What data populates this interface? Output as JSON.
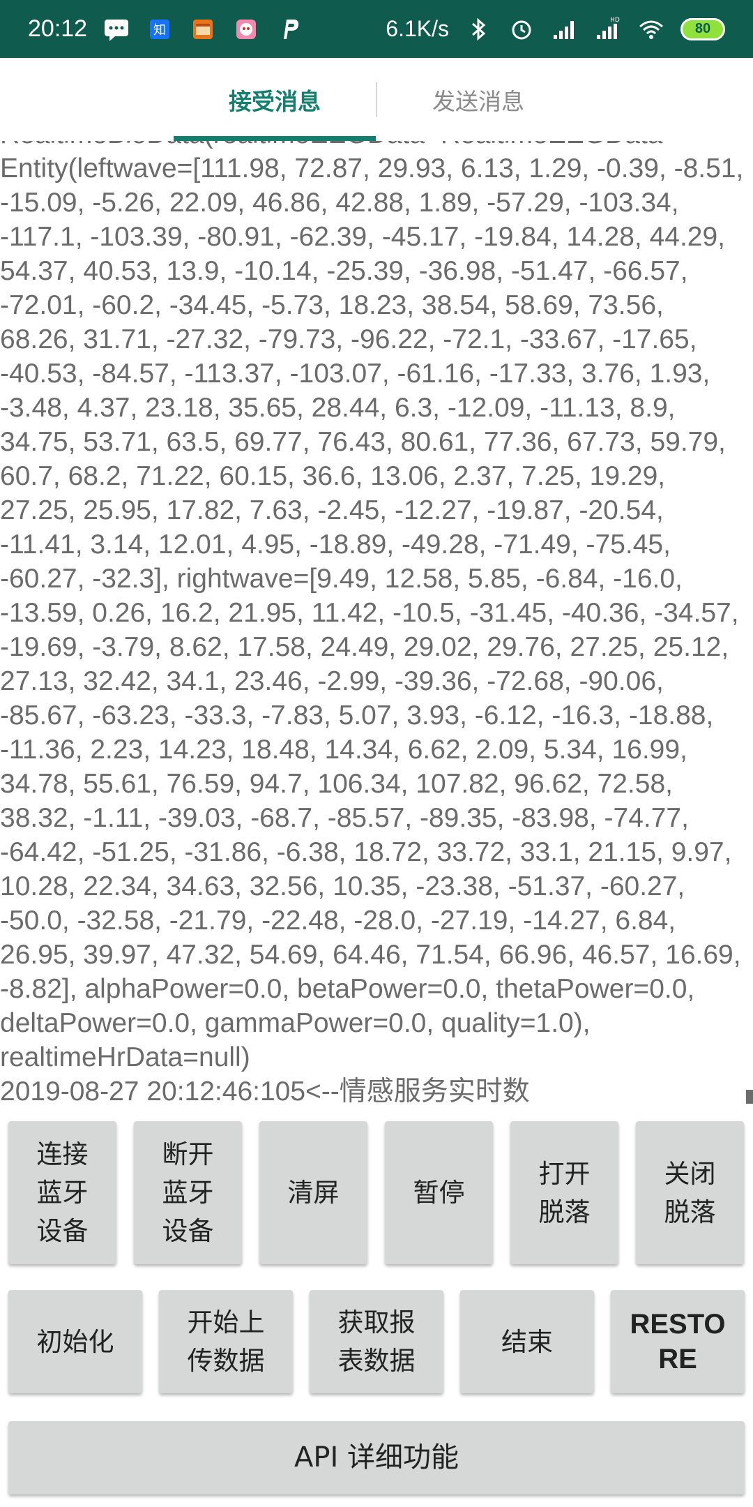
{
  "status_bar": {
    "time": "20:12",
    "net_speed": "6.1K/s",
    "battery": "80",
    "notification_icons": [
      "message-icon",
      "zhihu-icon",
      "calendar-app-icon",
      "app-icon",
      "p-app-icon"
    ],
    "system_icons": [
      "bluetooth-icon",
      "alarm-icon",
      "signal-icon",
      "hd-signal-icon",
      "wifi-icon"
    ],
    "bar_color": "#0f5c4e",
    "battery_color": "#8ee23b"
  },
  "tabs": {
    "receive": "接受消息",
    "send": "发送消息",
    "active_color": "#147f6f"
  },
  "log": {
    "text": "RealtimeBioData(realtimeEEGData=RealtimeEEGData\nEntity(leftwave=[111.98, 72.87, 29.93, 6.13, 1.29, -0.39, -8.51, -15.09, -5.26, 22.09, 46.86, 42.88, 1.89, -57.29, -103.34, -117.1, -103.39, -80.91, -62.39, -45.17, -19.84, 14.28, 44.29, 54.37, 40.53, 13.9, -10.14, -25.39, -36.98, -51.47, -66.57, -72.01, -60.2, -34.45, -5.73, 18.23, 38.54, 58.69, 73.56, 68.26, 31.71, -27.32, -79.73, -96.22, -72.1, -33.67, -17.65, -40.53, -84.57, -113.37, -103.07, -61.16, -17.33, 3.76, 1.93, -3.48, 4.37, 23.18, 35.65, 28.44, 6.3, -12.09, -11.13, 8.9, 34.75, 53.71, 63.5, 69.77, 76.43, 80.61, 77.36, 67.73, 59.79, 60.7, 68.2, 71.22, 60.15, 36.6, 13.06, 2.37, 7.25, 19.29, 27.25, 25.95, 17.82, 7.63, -2.45, -12.27, -19.87, -20.54, -11.41, 3.14, 12.01, 4.95, -18.89, -49.28, -71.49, -75.45, -60.27, -32.3], rightwave=[9.49, 12.58, 5.85, -6.84, -16.0, -13.59, 0.26, 16.2, 21.95, 11.42, -10.5, -31.45, -40.36, -34.57, -19.69, -3.79, 8.62, 17.58, 24.49, 29.02, 29.76, 27.25, 25.12, 27.13, 32.42, 34.1, 23.46, -2.99, -39.36, -72.68, -90.06, -85.67, -63.23, -33.3, -7.83, 5.07, 3.93, -6.12, -16.3, -18.88, -11.36, 2.23, 14.23, 18.48, 14.34, 6.62, 2.09, 5.34, 16.99, 34.78, 55.61, 76.59, 94.7, 106.34, 107.82, 96.62, 72.58, 38.32, -1.11, -39.03, -68.7, -85.57, -89.35, -83.98, -74.77, -64.42, -51.25, -31.86, -6.38, 18.72, 33.72, 33.1, 21.15, 9.97, 10.28, 22.34, 34.63, 32.56, 10.35, -23.38, -51.37, -60.27, -50.0, -32.58, -21.79, -22.48, -28.0, -27.19, -14.27, 6.84, 26.95, 39.97, 47.32, 54.69, 64.46, 71.54, 66.96, 46.57, 16.69, -8.82], alphaPower=0.0, betaPower=0.0, thetaPower=0.0, deltaPower=0.0, gammaPower=0.0, quality=1.0), realtimeHrData=null)\n2019-08-27 20:12:46:105<--情感服务实时数"
  },
  "buttons": {
    "row1": [
      "连接\n蓝牙\n设备",
      "断开\n蓝牙\n设备",
      "清屏",
      "暂停",
      "打开\n脱落",
      "关闭\n脱落"
    ],
    "row2": [
      "初始化",
      "开始上\n传数据",
      "获取报\n表数据",
      "结束",
      "RESTO\nRE"
    ],
    "api": "API 详细功能"
  }
}
